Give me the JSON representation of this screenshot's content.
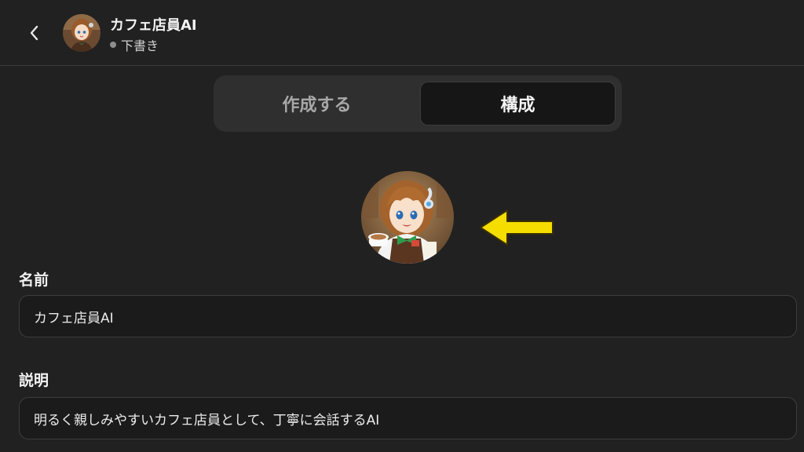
{
  "header": {
    "back_icon": "chevron-left-icon",
    "title": "カフェ店員AI",
    "status": "下書き",
    "status_dot_color": "#8e8e8e"
  },
  "tabs": [
    {
      "label": "作成する",
      "selected": false
    },
    {
      "label": "構成",
      "selected": true
    }
  ],
  "avatar": {
    "icon": "gpt-avatar-image",
    "annotation_arrow_color": "#f5dd00"
  },
  "form": {
    "name_label": "名前",
    "name_value": "カフェ店員AI",
    "description_label": "説明",
    "description_value": "明るく親しみやすいカフェ店員として、丁寧に会話するAI"
  },
  "colors": {
    "background": "#212121",
    "tab_track": "#2f2f2f",
    "tab_active": "#161616",
    "field_bg": "#1b1b1b",
    "field_border": "#3d3d3d"
  }
}
